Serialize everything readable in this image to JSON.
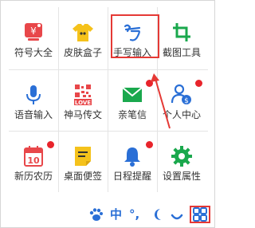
{
  "items": [
    {
      "label": "符号大全",
      "icon": "yen-sign-card-icon",
      "color": "#e8474a",
      "badge": false
    },
    {
      "label": "皮肤盒子",
      "icon": "tshirt-icon",
      "color": "#f5c21b",
      "badge": false
    },
    {
      "label": "手写输入",
      "icon": "handwriting-icon",
      "color": "#2a6fd6",
      "badge": false,
      "selected": true
    },
    {
      "label": "截图工具",
      "icon": "crop-icon",
      "color": "#1aa84d",
      "badge": false
    },
    {
      "label": "语音输入",
      "icon": "microphone-icon",
      "color": "#2a6fd6",
      "badge": false
    },
    {
      "label": "神马传文",
      "icon": "qr-love-icon",
      "color": "#e8474a",
      "badge": false
    },
    {
      "label": "亲笔信",
      "icon": "envelope-icon",
      "color": "#1aa84d",
      "badge": true
    },
    {
      "label": "个人中心",
      "icon": "user-coin-icon",
      "color": "#2a6fd6",
      "badge": true
    },
    {
      "label": "新历农历",
      "icon": "calendar-icon",
      "color": "#e8474a",
      "badge": true,
      "calendar_day": "10"
    },
    {
      "label": "桌面便签",
      "icon": "sticky-note-icon",
      "color": "#f5c21b",
      "badge": false
    },
    {
      "label": "日程提醒",
      "icon": "bell-icon",
      "color": "#2a6fd6",
      "badge": true
    },
    {
      "label": "设置属性",
      "icon": "gear-icon",
      "color": "#1aa84d",
      "badge": false
    }
  ],
  "statusbar": {
    "paw_icon": "paw-icon",
    "lang_label": "中",
    "punct_label": "°,",
    "moon_icon": "moon-icon",
    "emoji_icon": "emoji-icon",
    "menu_icon": "grid-menu-icon"
  },
  "colors": {
    "accent_blue": "#2a6fd6",
    "red": "#e8474a",
    "yellow": "#f5c21b",
    "green": "#1aa84d",
    "highlight": "#e53935",
    "badge": "#e8242b"
  }
}
